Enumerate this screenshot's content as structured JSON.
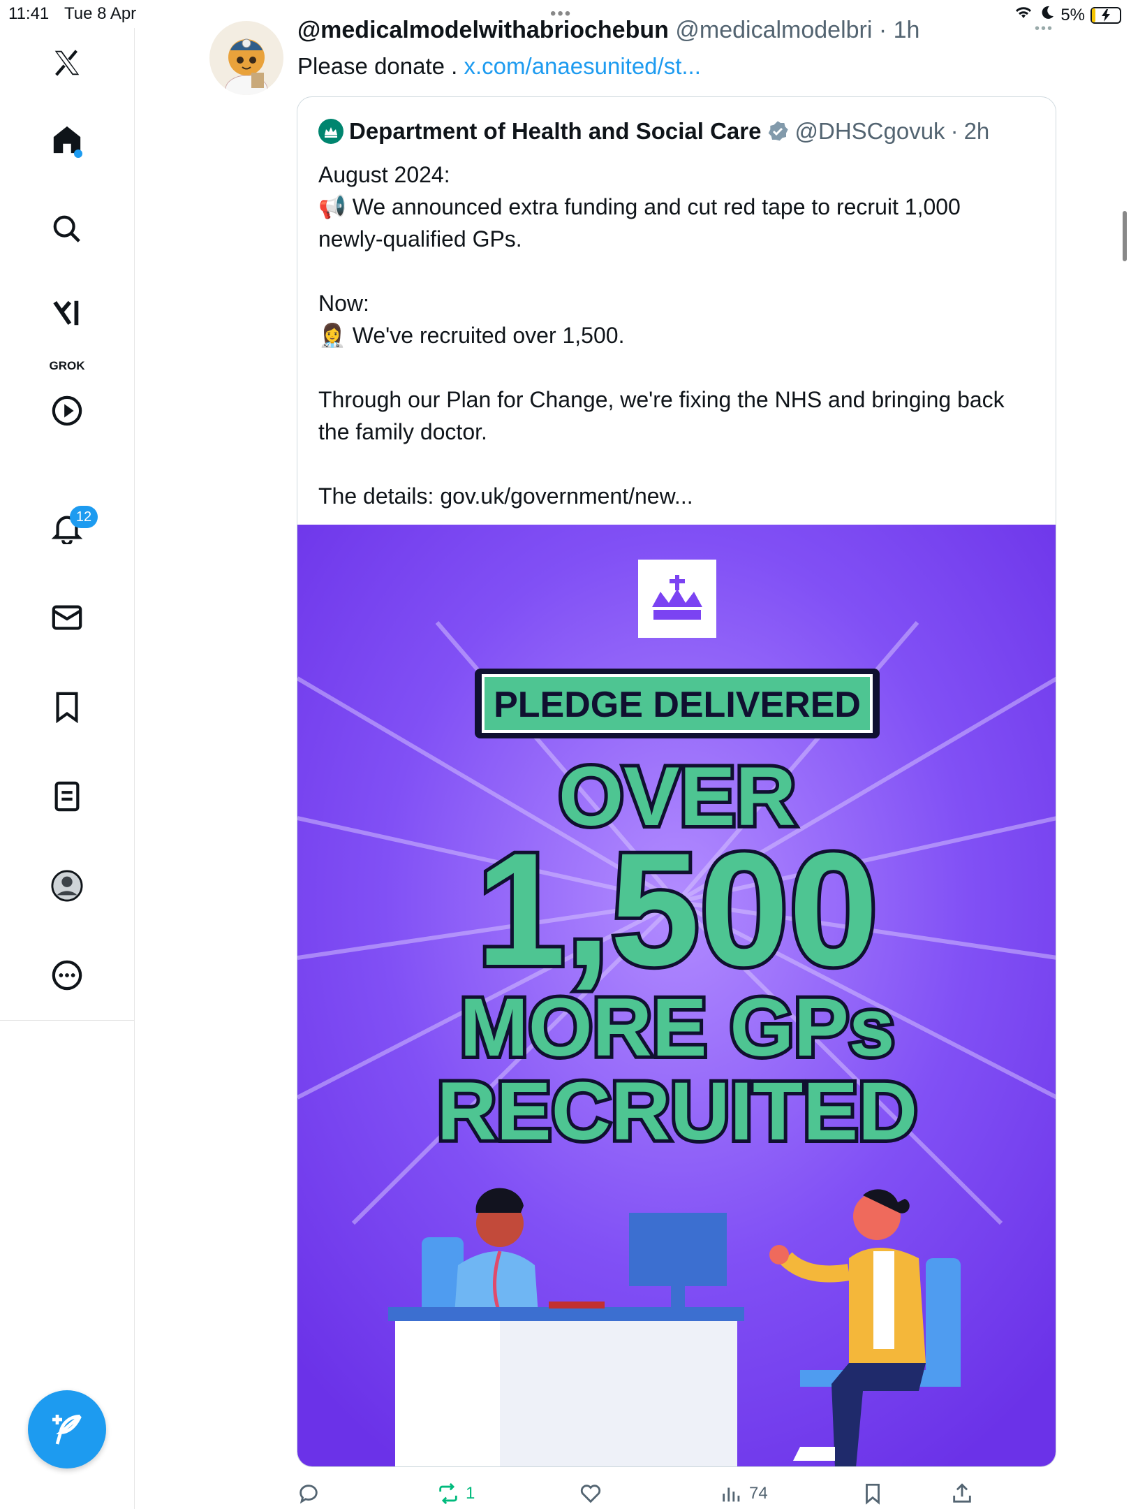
{
  "status_bar": {
    "time": "11:41",
    "date": "Tue 8 Apr",
    "battery": "5%"
  },
  "sidebar": {
    "grok_label": "GROK",
    "notification_count": "12",
    "items": [
      "home",
      "explore",
      "grok",
      "videos",
      "notifications",
      "messages",
      "bookmarks",
      "lists",
      "profile",
      "more"
    ]
  },
  "post": {
    "display_name": "@medicalmodelwithabriochebun",
    "handle": "@medicalmodelbri",
    "time": "1h",
    "text": "Please donate . ",
    "link": "x.com/anaesunited/st..."
  },
  "quote": {
    "display_name": "Department of Health and Social Care",
    "handle": "@DHSCgovuk",
    "time": "2h",
    "body": "August 2024:\n📢 We announced extra funding and cut red tape to recruit 1,000 newly-qualified GPs.\n\nNow:\n👩‍⚕️ We've recruited over 1,500.\n\nThrough our Plan for Change, we're fixing the NHS and bringing back the family doctor.\n\nThe details: gov.uk/government/new...",
    "image": {
      "banner": "PLEDGE DELIVERED",
      "line1": "OVER",
      "line2": "1,500",
      "line3": "MORE GPs",
      "line4": "RECRUITED",
      "bg_color": "#7b43f2",
      "text_color": "#4ec592"
    }
  },
  "actions": {
    "reposts": "1",
    "views": "74"
  },
  "colors": {
    "accent": "#1d9bf0",
    "repost_green": "#00ba7c"
  }
}
